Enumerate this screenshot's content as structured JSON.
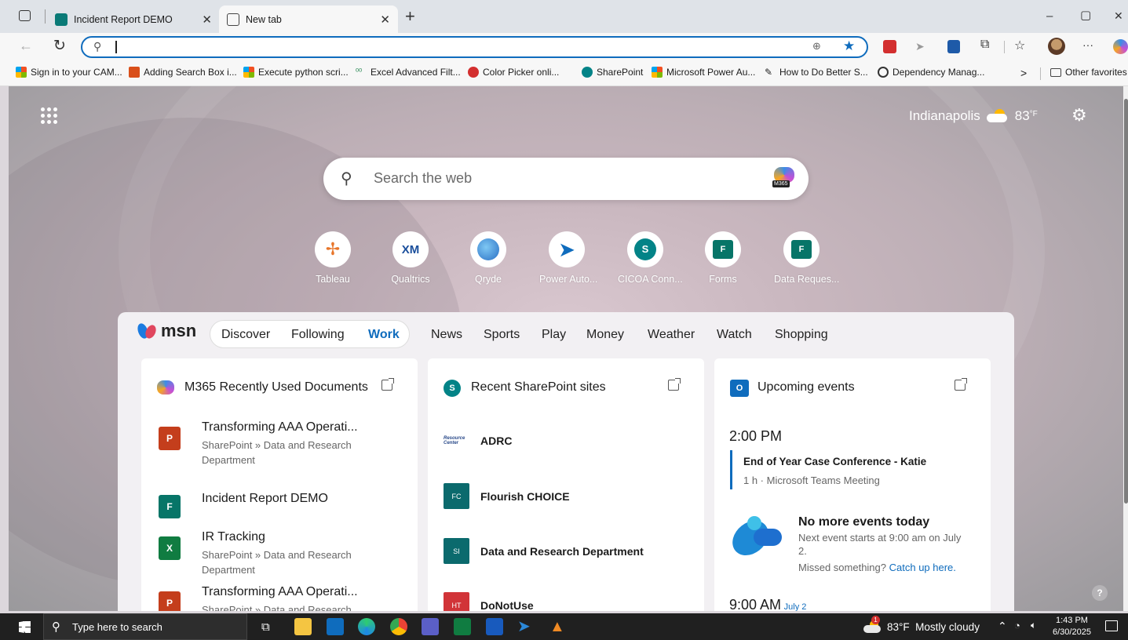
{
  "browser": {
    "tabs": [
      {
        "label": "Incident Report DEMO",
        "active": false
      },
      {
        "label": "New tab",
        "active": true
      }
    ],
    "new_tab_symbol": "+",
    "window_controls": {
      "minimize": "–",
      "maximize": "▢",
      "close": "✕"
    },
    "address_value": "",
    "more_menu": "···"
  },
  "favorites": {
    "items": [
      "Sign in to your CAM...",
      "Adding Search Box i...",
      "Execute python scri...",
      "Excel Advanced Filt...",
      "Color Picker onli...",
      "SharePoint",
      "Microsoft Power Au...",
      "How to Do Better S...",
      "Dependency Manag..."
    ],
    "overflow": ">",
    "other": "Other favorites"
  },
  "newtab": {
    "weather": {
      "city": "Indianapolis",
      "temp": "83",
      "unit": "°F"
    },
    "search": {
      "placeholder": "Search the web",
      "badge": "M365"
    },
    "quick_links": [
      {
        "label": "Tableau",
        "icon": "tableau-icon",
        "color": "#e8762b"
      },
      {
        "label": "Qualtrics",
        "icon": "qualtrics-icon",
        "color": "#1b4f9c"
      },
      {
        "label": "Qryde",
        "icon": "qryde-icon",
        "color": "#2a8fd6"
      },
      {
        "label": "Power Auto...",
        "icon": "power-automate-icon",
        "color": "#0f6cbd"
      },
      {
        "label": "CICOA Conn...",
        "icon": "sharepoint-icon",
        "color": "#038387"
      },
      {
        "label": "Forms",
        "icon": "forms-icon",
        "color": "#077568"
      },
      {
        "label": "Data Reques...",
        "icon": "forms-icon",
        "color": "#077568"
      }
    ]
  },
  "msn": {
    "logo": "msn",
    "tabs_group": [
      "Discover",
      "Following",
      "Work"
    ],
    "active_tab": "Work",
    "tabs": [
      "News",
      "Sports",
      "Play",
      "Money",
      "Weather",
      "Watch",
      "Shopping"
    ]
  },
  "cards": {
    "docs": {
      "title": "M365 Recently Used Documents",
      "items": [
        {
          "name": "Transforming AAA Operati...",
          "path": "SharePoint » Data and Research Department",
          "type": "P"
        },
        {
          "name": "Incident Report DEMO",
          "path": "",
          "type": "F"
        },
        {
          "name": "IR Tracking",
          "path": "SharePoint » Data and Research Department",
          "type": "X"
        },
        {
          "name": "Transforming AAA Operati...",
          "path": "SharePoint » Data and Research",
          "type": "P"
        }
      ]
    },
    "sites": {
      "title": "Recent SharePoint sites",
      "items": [
        {
          "abbr": "Resource Center",
          "label": "ADRC",
          "color": "#ffffff"
        },
        {
          "abbr": "FC",
          "label": "Flourish CHOICE",
          "color": "#0b6a6d"
        },
        {
          "abbr": "SI",
          "label": "Data and Research Department",
          "color": "#0b6a6d"
        },
        {
          "abbr": "HT",
          "label": "DoNotUse",
          "color": "#d13438"
        }
      ]
    },
    "events": {
      "title": "Upcoming events",
      "time1": "2:00 PM",
      "event1_title": "End of Year Case Conference - Katie",
      "event1_meta": "1 h · Microsoft Teams Meeting",
      "no_more_title": "No more events today",
      "next_line1": "Next event starts at 9:00 am on July",
      "next_line2": "2.",
      "missed": "Missed something?",
      "catch_up": "Catch up here.",
      "time2": "9:00 AM",
      "time2_date": "July 2"
    }
  },
  "help": "?",
  "taskbar": {
    "search_placeholder": "Type here to search",
    "weather": "83°F  Mostly cloudy",
    "time": "1:43 PM",
    "date": "6/30/2025",
    "notification_badge": "1"
  }
}
